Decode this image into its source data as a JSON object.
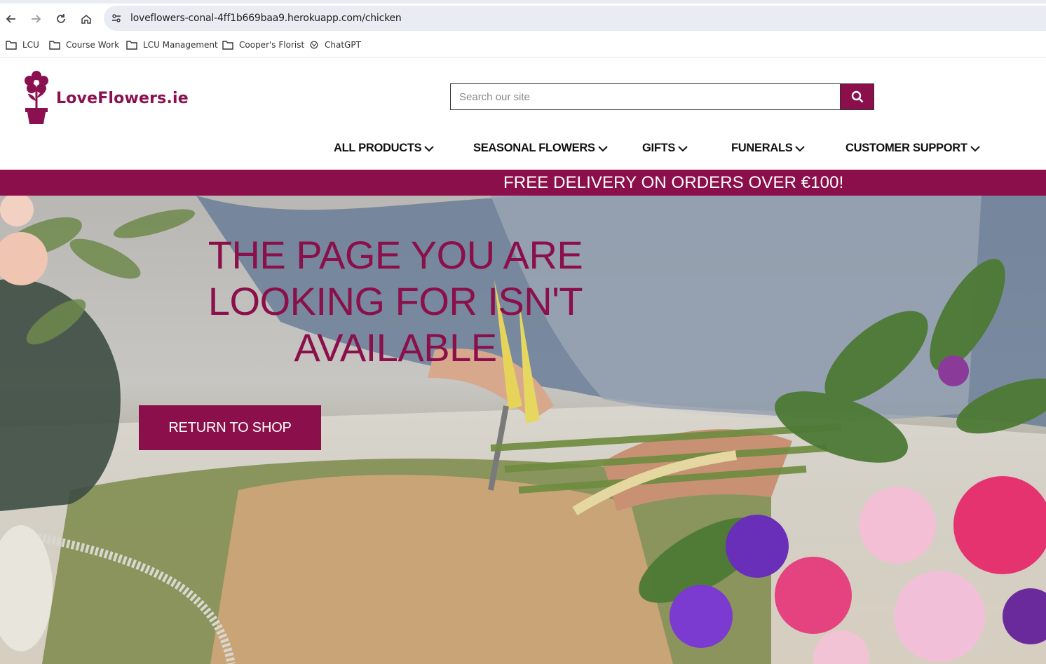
{
  "browser": {
    "url": "loveflowers-conal-4ff1b669baa9.herokuapp.com/chicken",
    "bookmarks": [
      {
        "label": "LCU",
        "icon": "folder-icon"
      },
      {
        "label": "Course Work",
        "icon": "folder-icon"
      },
      {
        "label": "LCU Management",
        "icon": "folder-icon"
      },
      {
        "label": "Cooper's Florist",
        "icon": "folder-icon"
      },
      {
        "label": "ChatGPT",
        "icon": "chatgpt-icon"
      }
    ]
  },
  "header": {
    "logo_text": "LoveFlowers.ie",
    "search_placeholder": "Search our site",
    "search_value": ""
  },
  "nav": {
    "items": [
      {
        "label": "ALL PRODUCTS"
      },
      {
        "label": "SEASONAL FLOWERS"
      },
      {
        "label": "GIFTS"
      },
      {
        "label": "FUNERALS"
      },
      {
        "label": "CUSTOMER SUPPORT"
      }
    ]
  },
  "promo": {
    "text": "FREE DELIVERY ON ORDERS OVER €100!"
  },
  "hero": {
    "title_line1": "THE PAGE YOU ARE",
    "title_line2": "LOOKING FOR ISN'T",
    "title_line3": "AVAILABLE",
    "button_label": "RETURN TO SHOP"
  },
  "colors": {
    "brand": "#8a0f4a",
    "url_bar": "#e9edf3"
  }
}
